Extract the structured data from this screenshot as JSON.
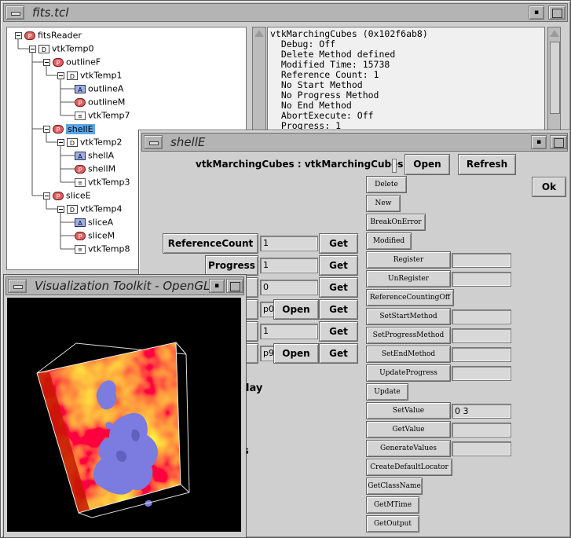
{
  "fits_window": {
    "title": "fits.tcl",
    "min_label": "▪",
    "tree": [
      {
        "badge": "P",
        "label": "fitsReader",
        "depth": 0,
        "box": true
      },
      {
        "badge": "D",
        "label": "vtkTemp0",
        "depth": 1,
        "box": true
      },
      {
        "badge": "P",
        "label": "outlineF",
        "depth": 2,
        "box": true
      },
      {
        "badge": "D",
        "label": "vtkTemp1",
        "depth": 3,
        "box": true
      },
      {
        "badge": "A",
        "label": "outlineA",
        "depth": 4,
        "box": false
      },
      {
        "badge": "P",
        "label": "outlineM",
        "depth": 4,
        "box": false
      },
      {
        "badge": "F",
        "label": "vtkTemp7",
        "depth": 4,
        "box": false
      },
      {
        "badge": "P",
        "label": "shellE",
        "depth": 2,
        "box": true,
        "selected": true
      },
      {
        "badge": "D",
        "label": "vtkTemp2",
        "depth": 3,
        "box": true
      },
      {
        "badge": "A",
        "label": "shellA",
        "depth": 4,
        "box": false
      },
      {
        "badge": "P",
        "label": "shellM",
        "depth": 4,
        "box": false
      },
      {
        "badge": "F",
        "label": "vtkTemp3",
        "depth": 4,
        "box": false
      },
      {
        "badge": "P",
        "label": "sliceE",
        "depth": 2,
        "box": true
      },
      {
        "badge": "D",
        "label": "vtkTemp4",
        "depth": 3,
        "box": true
      },
      {
        "badge": "A",
        "label": "sliceA",
        "depth": 4,
        "box": false
      },
      {
        "badge": "P",
        "label": "sliceM",
        "depth": 4,
        "box": false
      },
      {
        "badge": "F",
        "label": "vtkTemp8",
        "depth": 4,
        "box": false
      }
    ],
    "info_lines": [
      "vtkMarchingCubes (0x102f6ab8)",
      "  Debug: Off",
      "  Delete Method defined",
      "  Modified Time: 15738",
      "  Reference Count: 1",
      "  No Start Method",
      "  No Progress Method",
      "  No End Method",
      "  AbortExecute: Off",
      "  Progress: 1"
    ]
  },
  "vis_window": {
    "title": "Visualization Toolkit - OpenGL",
    "min_label": "▪"
  },
  "shell_window": {
    "title": "shellE",
    "min_label": "▪",
    "header": "vtkMarchingCubes : vtkMarchingCubes",
    "open_label": "Open",
    "refresh_label": "Refresh",
    "ok_label": "Ok",
    "get_label": "Get",
    "open_row_label": "Open",
    "props": [
      {
        "label": "ReferenceCount",
        "value": "1"
      },
      {
        "label": "Progress",
        "value": "1"
      },
      {
        "label": "",
        "value": "0"
      },
      {
        "label": "",
        "value": "p0"
      },
      {
        "label": "",
        "value": "1"
      },
      {
        "label": "",
        "value": "p9"
      }
    ],
    "partial_text_1": "lay",
    "partial_text_2": "s",
    "methods": [
      {
        "label": "Delete"
      },
      {
        "label": "New"
      },
      {
        "label": "BreakOnError"
      },
      {
        "label": "Modified"
      },
      {
        "label": "Register",
        "entry": ""
      },
      {
        "label": "UnRegister",
        "entry": ""
      },
      {
        "label": "ReferenceCountingOff"
      },
      {
        "label": "SetStartMethod",
        "entry": ""
      },
      {
        "label": "SetProgressMethod",
        "entry": ""
      },
      {
        "label": "SetEndMethod",
        "entry": ""
      },
      {
        "label": "UpdateProgress",
        "entry": ""
      },
      {
        "label": "Update"
      },
      {
        "label": "SetValue",
        "entry": "0 3"
      },
      {
        "label": "GetValue",
        "entry": ""
      },
      {
        "label": "GenerateValues",
        "entry": ""
      },
      {
        "label": "CreateDefaultLocator"
      },
      {
        "label": "GetClassName"
      },
      {
        "label": "GetMTime"
      },
      {
        "label": "GetOutput"
      }
    ]
  },
  "colors": {
    "selection": "#5aa6e8",
    "isosurface": "#7b7be0",
    "slab_hot": "#ff3010",
    "slab_warm": "#ffd000"
  }
}
